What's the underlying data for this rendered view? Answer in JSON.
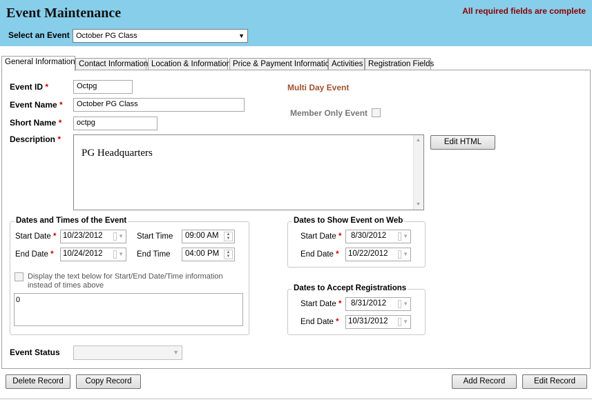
{
  "header": {
    "title": "Event Maintenance",
    "status_message": "All required fields are complete",
    "select_label": "Select an Event",
    "selected_event": "October PG Class"
  },
  "tabs": [
    {
      "label": "General Information"
    },
    {
      "label": "Contact Information"
    },
    {
      "label": "Location & Information"
    },
    {
      "label": "Price & Payment Information"
    },
    {
      "label": "Activities"
    },
    {
      "label": "Registration Fields"
    }
  ],
  "general": {
    "event_id_label": "Event ID",
    "event_id": "Octpg",
    "event_name_label": "Event Name",
    "event_name": "October PG Class",
    "short_name_label": "Short Name",
    "short_name": "octpg",
    "description_label": "Description",
    "description": "PG Headquarters",
    "required_mark": "*",
    "multi_day_label": "Multi Day Event",
    "member_only_label": "Member Only Event",
    "edit_html_button": "Edit HTML"
  },
  "event_dates": {
    "title": "Dates and Times of the Event",
    "start_date_label": "Start Date",
    "start_date": "10/23/2012",
    "end_date_label": "End Date",
    "end_date": "10/24/2012",
    "start_time_label": "Start Time",
    "start_time": "09:00 AM",
    "end_time_label": "End Time",
    "end_time": "04:00 PM",
    "display_text_label": "Display the text below for Start/End Date/Time information instead of times above",
    "display_text_value": "0"
  },
  "web_dates": {
    "title": "Dates to Show Event on Web",
    "start_date_label": "Start Date",
    "start_date": "8/30/2012",
    "end_date_label": "End Date",
    "end_date": "10/22/2012"
  },
  "registration_dates": {
    "title": "Dates to Accept Registrations",
    "start_date_label": "Start Date",
    "start_date": "8/31/2012",
    "end_date_label": "End Date",
    "end_date": "10/31/2012"
  },
  "status": {
    "label": "Event Status",
    "value": ""
  },
  "footer": {
    "delete_button": "Delete Record",
    "copy_button": "Copy Record",
    "add_button": "Add Record",
    "edit_button": "Edit Record"
  },
  "colors": {
    "header_bg": "#87ceeb",
    "status_message": "#8b0000",
    "multi_day": "#a0522d",
    "required": "#cc0000"
  }
}
